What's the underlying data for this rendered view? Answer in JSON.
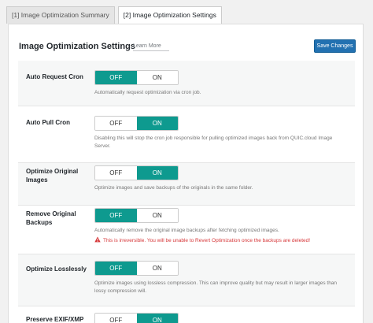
{
  "tabs": [
    {
      "label": "[1] Image Optimization Summary"
    },
    {
      "label": "[2] Image Optimization Settings"
    }
  ],
  "page": {
    "title": "Image Optimization Settings",
    "learn_more": "Learn More",
    "save_label": "Save Changes"
  },
  "toggle": {
    "off": "OFF",
    "on": "ON"
  },
  "settings": [
    {
      "label": "Auto Request Cron",
      "state": "off",
      "description": "Automatically request optimization via cron job."
    },
    {
      "label": "Auto Pull Cron",
      "state": "on",
      "description": "Disabling this will stop the cron job responsible for pulling optimized images back from QUIC.cloud Image Server."
    },
    {
      "label": "Optimize Original Images",
      "state": "on",
      "description": "Optimize images and save backups of the originals in the same folder."
    },
    {
      "label": "Remove Original Backups",
      "state": "off",
      "description": "Automatically remove the original image backups after fetching optimized images.",
      "warning": "This is irreversible. You will be unable to Revert Optimization once the backups are deleted!"
    },
    {
      "label": "Optimize Losslessly",
      "state": "off",
      "description": "Optimize images using lossless compression. This can improve quality but may result in larger images than lossy compression will."
    },
    {
      "label": "Preserve EXIF/XMP",
      "state": "on",
      "description": ""
    }
  ],
  "colors": {
    "accent": "#0e9a8f",
    "primary_button": "#2271b1",
    "warning": "#d63638"
  }
}
